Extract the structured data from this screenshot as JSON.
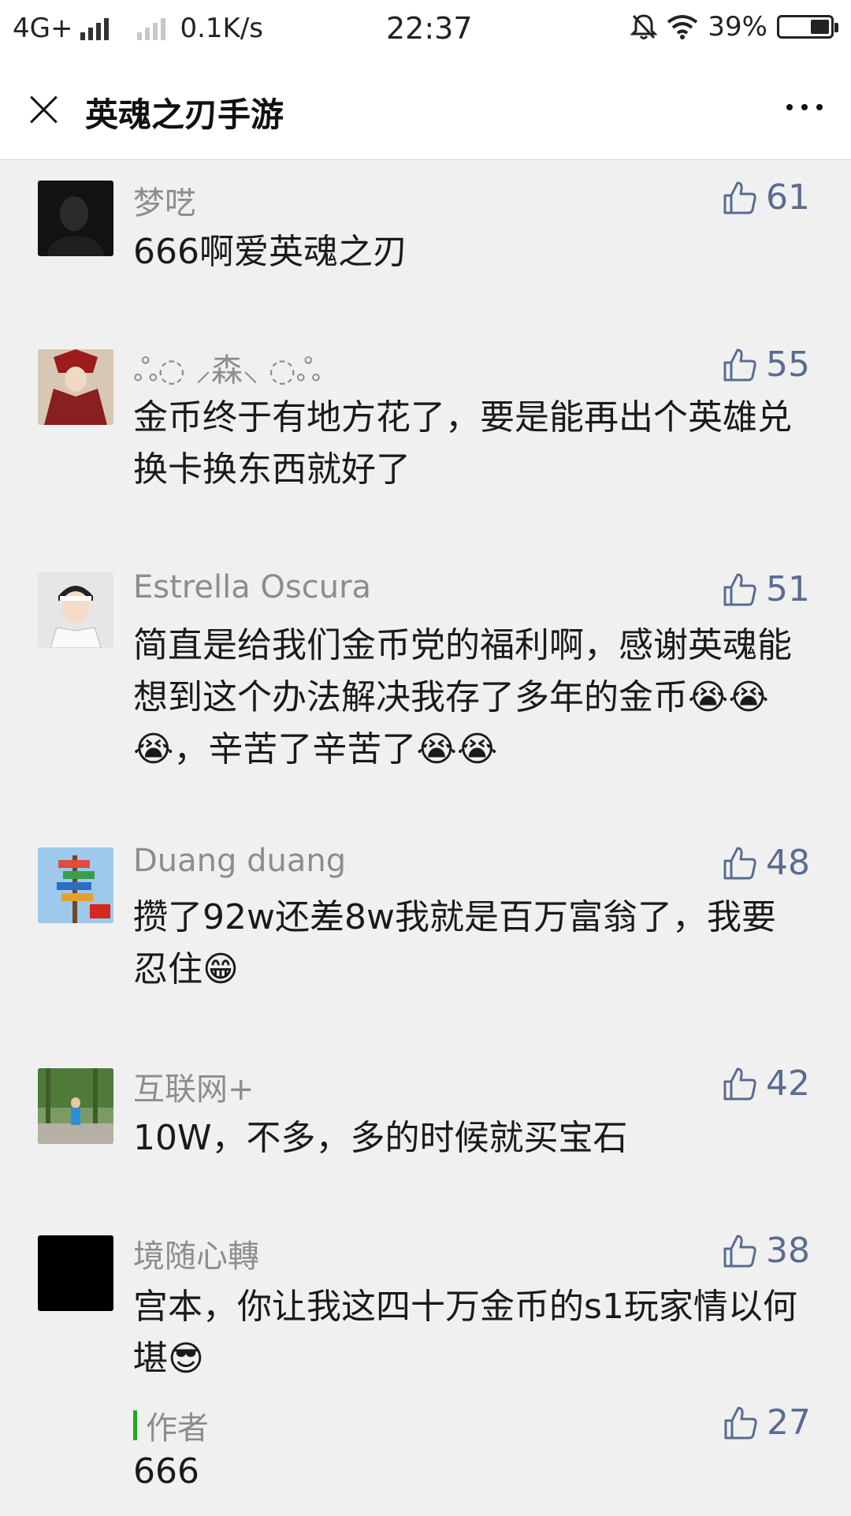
{
  "status_bar": {
    "network": "4G+",
    "speed": "0.1K/s",
    "time": "22:37",
    "battery": "39%",
    "battery_level": 0.39
  },
  "header": {
    "title": "英魂之刃手游",
    "close_icon": "close-icon",
    "more_icon": "more-dots-icon"
  },
  "comments": [
    {
      "name": "梦呓",
      "text": "666啊爱英魂之刃",
      "likes": "61",
      "avatar_color": "#151515"
    },
    {
      "name": "༄❄✝✨森✨✝❄༄",
      "name_display": "ஃ◌ ⸝森⸜ ◌ஃ",
      "text": "金币终于有地方花了，要是能再出个英雄兑换卡换东西就好了",
      "likes": "55",
      "avatar_color": "#8a2a2a"
    },
    {
      "name": "Estrella Oscura",
      "text": "简直是给我们金币党的福利啊，感谢英魂能想到这个办法解决我存了多年的金币😭😭😭，辛苦了辛苦了😭😭",
      "likes": "51",
      "avatar_color": "#d9d9d9"
    },
    {
      "name": "Duang duang",
      "text": "攒了92w还差8w我就是百万富翁了，我要忍住😁",
      "likes": "48",
      "avatar_color": "#6fa8d8"
    },
    {
      "name": "互联网+",
      "text": "10W，不多，多的时候就买宝石",
      "likes": "42",
      "avatar_color": "#5b7a4a"
    },
    {
      "name": "境随心轉",
      "text": "宫本，你让我这四十万金币的s1玩家情以何堪😎",
      "likes": "38",
      "avatar_color": "#000000"
    }
  ],
  "author_reply": {
    "label": "作者",
    "text": "666",
    "likes": "27"
  },
  "colors": {
    "like": "#5a6b91",
    "name": "#8d8d8d",
    "author_bar": "#1aad19"
  }
}
